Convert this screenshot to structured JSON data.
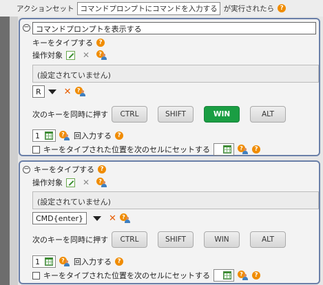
{
  "header": {
    "pre": "アクションセット",
    "action_set_name": "コマンドプロンプトにコマンドを入力する",
    "post": "が実行されたら",
    "help_glyph": "?"
  },
  "block1": {
    "command_title": "コマンドプロンプトを表示する",
    "section_title": "キーをタイプする",
    "target_label": "操作対象",
    "target_value": "(設定されていません)",
    "key_value": "R",
    "modifier_label": "次のキーを同時に押す",
    "modifiers": [
      "CTRL",
      "SHIFT",
      "WIN",
      "ALT"
    ],
    "modifiers_active": [
      "WIN"
    ],
    "repeat_value": "1",
    "repeat_label": "回入力する",
    "set_cell_label": "キーをタイプされた位置を次のセルにセットする",
    "set_cell_checked": false
  },
  "block2": {
    "section_title": "キーをタイプする",
    "target_label": "操作対象",
    "target_value": "(設定されていません)",
    "key_value": "CMD{enter}",
    "modifier_label": "次のキーを同時に押す",
    "modifiers": [
      "CTRL",
      "SHIFT",
      "WIN",
      "ALT"
    ],
    "modifiers_active": [],
    "repeat_value": "1",
    "repeat_label": "回入力する",
    "set_cell_label": "キーをタイプされた位置を次のセルにセットする",
    "set_cell_checked": false
  },
  "colors": {
    "accent_help": "#f08c00",
    "active_button": "#1a9e43",
    "panel_border": "#6a7fa8",
    "delete_x": "#e85d00"
  },
  "icons": [
    "help-icon",
    "edit-target-icon",
    "clear-icon",
    "person-help-icon",
    "dropdown-arrow-icon",
    "delete-icon",
    "cell-grid-icon",
    "minus-collapse-icon"
  ]
}
